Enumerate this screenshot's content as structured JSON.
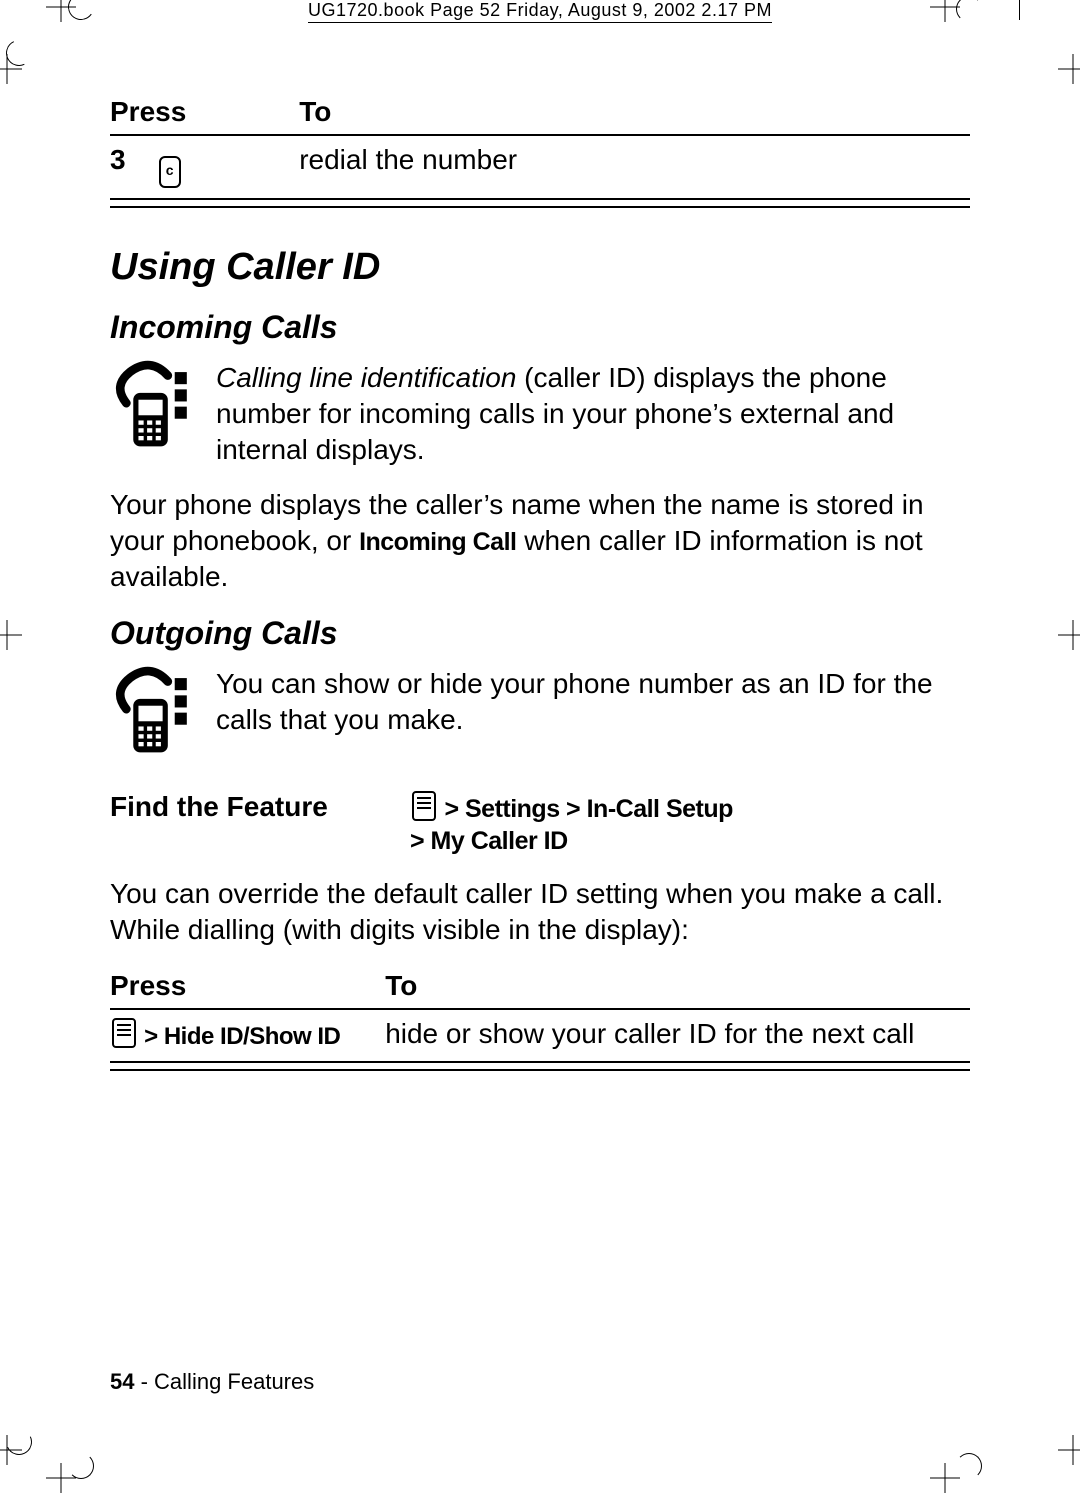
{
  "header_banner": "UG1720.book  Page 52  Friday, August 9, 2002  2.17 PM",
  "table1": {
    "head_press": "Press",
    "head_to": "To",
    "step_num": "3",
    "step_to": "redial the number"
  },
  "h1": "Using Caller ID",
  "incoming": {
    "heading": "Incoming Calls",
    "p1_lead": "Calling line identification",
    "p1_rest": " (caller ID) displays the phone number for incoming calls in your phone’s external and internal displays.",
    "p2_a": "Your phone displays the caller’s name when the name is stored in your phonebook, or ",
    "p2_bold": "Incoming Call",
    "p2_b": " when caller ID information is not available."
  },
  "outgoing": {
    "heading": "Outgoing Calls",
    "p1": "You can show or hide your phone number as an ID for the calls that you make."
  },
  "find_feature": {
    "label": "Find the Feature",
    "path_line1": " > Settings > In-Call Setup",
    "path_line2": "> My Caller ID"
  },
  "override_p": "You can override the default caller ID setting when you make a call. While dialling (with digits visible in the display):",
  "table2": {
    "head_press": "Press",
    "head_to": "To",
    "press_text": " > Hide ID/Show ID",
    "to_text": "hide or show your caller ID for the next call"
  },
  "footer": {
    "page": "54",
    "sep": " - ",
    "chapter": "Calling Features"
  }
}
